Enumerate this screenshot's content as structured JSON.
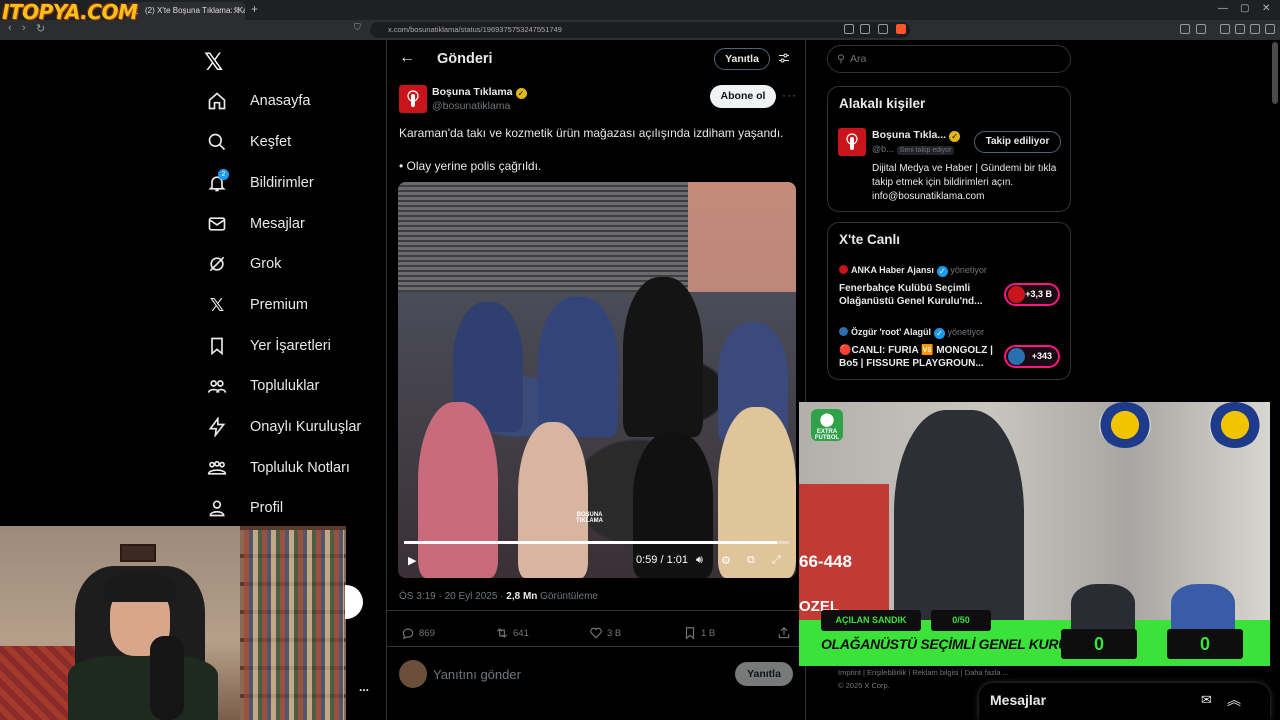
{
  "browser": {
    "overlay_logo": "ITOPYA.COM",
    "tab_title": "(2) X'te Boşuna Tıklama: \"Karama...",
    "url": "x.com/bosunatiklama/status/1969375753247551749"
  },
  "nav": {
    "items": [
      {
        "label": "Anasayfa",
        "icon": "home-icon"
      },
      {
        "label": "Keşfet",
        "icon": "search-icon"
      },
      {
        "label": "Bildirimler",
        "icon": "bell-icon",
        "badge": "2"
      },
      {
        "label": "Mesajlar",
        "icon": "mail-icon"
      },
      {
        "label": "Grok",
        "icon": "grok-icon"
      },
      {
        "label": "Premium",
        "icon": "x-icon"
      },
      {
        "label": "Yer İşaretleri",
        "icon": "bookmark-icon"
      },
      {
        "label": "Topluluklar",
        "icon": "communities-icon"
      },
      {
        "label": "Onaylı Kuruluşlar",
        "icon": "lightning-icon"
      },
      {
        "label": "Topluluk Notları",
        "icon": "community-notes-icon"
      },
      {
        "label": "Profil",
        "icon": "profile-icon"
      }
    ],
    "more": "..."
  },
  "post_header": {
    "title": "Gönderi",
    "reply_button": "Yanıtla"
  },
  "post": {
    "author_name": "Boşuna Tıklama",
    "author_handle": "@bosunatiklama",
    "follow_button": "Abone ol",
    "text_line1": "Karaman'da takı ve kozmetik ürün mağazası açılışında izdiham yaşandı.",
    "text_line2": "• Olay yerine polis çağrıldı.",
    "video": {
      "time": "0:59 / 1:01",
      "progress": 0.97,
      "watermark_line1": "BOŞUNA",
      "watermark_line2": "TIKLAMA"
    },
    "meta_time": "ÖS 3:19 · 20 Eyl 2025 · ",
    "meta_views": "2,8 Mn",
    "meta_views_label": " Görüntüleme",
    "actions": {
      "replies": "869",
      "reposts": "641",
      "likes": "3 B",
      "bookmarks": "1 B"
    },
    "reply_placeholder": "Yanıtını gönder",
    "reply_send": "Yanıtla"
  },
  "sidebar": {
    "search_placeholder": "Ara",
    "related": {
      "title": "Alakalı kişiler",
      "name": "Boşuna Tıkla...",
      "handle": "@b...",
      "follows_you": "Seni takip ediyor",
      "following_button": "Takip ediliyor",
      "bio": "Dijital Medya ve Haber | Gündemi bir tıkla takip etmek için bildirimleri açın. info@bosunatiklama.com"
    },
    "live": {
      "title": "X'te Canlı",
      "items": [
        {
          "source": "ANKA Haber Ajansı",
          "role": "yönetiyor",
          "title": "Fenerbahçe Kulübü Seçimli Olağanüstü Genel Kurulu'nd...",
          "count": "+3,3 B"
        },
        {
          "source": "Özgür 'root' Alagül",
          "role": "yönetiyor",
          "title": "🔴CANLI: FURIA 🆚 MONGOLZ | Bo5 | FISSURE PLAYGROUN...",
          "count": "+343"
        }
      ]
    },
    "footer_links": "Imprint  |  Erişilebilirlik  |  Reklam bilgisi  |  Daha fazla ...",
    "footer_copy": "© 2025 X Corp.",
    "messages_dock": "Mesajlar"
  },
  "sports_overlay": {
    "channel": "EXTRA FUTBOL",
    "wall_text1": "66-448",
    "wall_text2": "OZEL",
    "tag1": "AÇILAN SANDIK",
    "tag2": "0/50",
    "headline": "OLAĞANÜSTÜ SEÇİMLİ GENEL KURUL",
    "score_left": "0",
    "score_right": "0"
  },
  "colors": {
    "accent": "#1d9bf0",
    "brand_red": "#c9141b",
    "live_pink": "#f91880",
    "overlay_green": "#3ae23a"
  }
}
